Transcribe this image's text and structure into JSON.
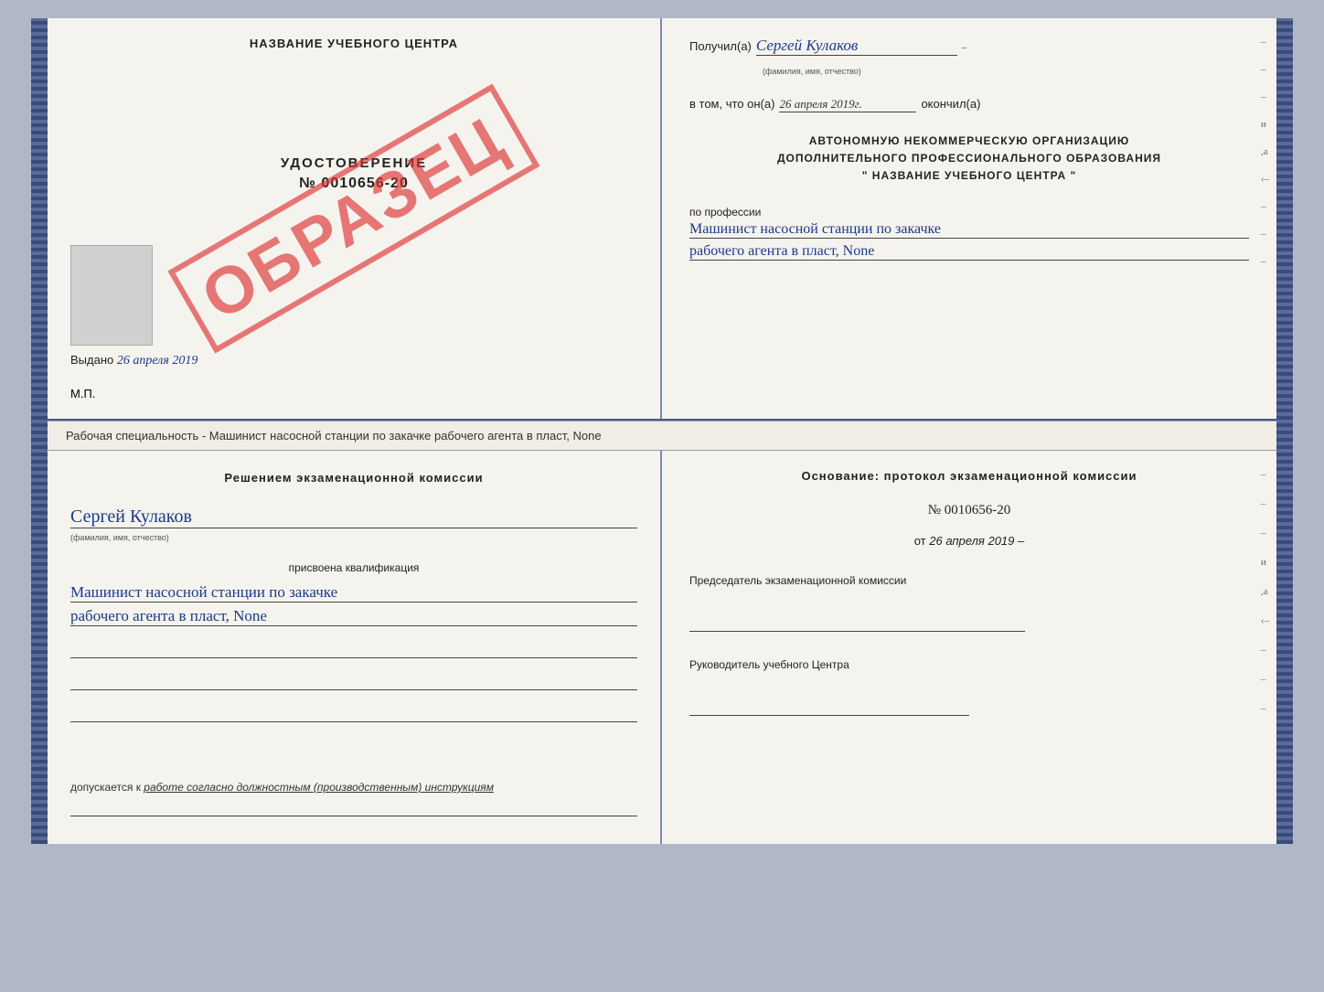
{
  "document": {
    "top": {
      "left": {
        "title": "НАЗВАНИЕ УЧЕБНОГО ЦЕНТРА",
        "cert_label": "УДОСТОВЕРЕНИЕ",
        "cert_number": "№ 0010656-20",
        "issued_prefix": "Выдано",
        "issued_date": "26 апреля 2019",
        "mp_label": "М.П.",
        "stamp_text": "ОБРАЗЕЦ"
      },
      "right": {
        "recipient_prefix": "Получил(а)",
        "recipient_name": "Сергей Кулаков",
        "recipient_sub": "(фамилия, имя, отчество)",
        "date_prefix": "в том, что он(а)",
        "date_value": "26 апреля 2019г.",
        "date_suffix": "окончил(а)",
        "org_line1": "АВТОНОМНУЮ НЕКОММЕРЧЕСКУЮ ОРГАНИЗАЦИЮ",
        "org_line2": "ДОПОЛНИТЕЛЬНОГО ПРОФЕССИОНАЛЬНОГО ОБРАЗОВАНИЯ",
        "org_line3": "\" НАЗВАНИЕ УЧЕБНОГО ЦЕНТРА \"",
        "profession_label": "по профессии",
        "profession_value1": "Машинист насосной станции по закачке",
        "profession_value2": "рабочего агента в пласт, None",
        "dash1": "–",
        "dash2": "–",
        "dash3": "–",
        "dash4": "и",
        "dash5": ",а",
        "dash6": "‹–",
        "dash7": "–",
        "dash8": "–",
        "dash9": "–"
      }
    },
    "separator": "Рабочая специальность - Машинист насосной станции по закачке рабочего агента в пласт, None",
    "bottom": {
      "left": {
        "commission_text": "Решением экзаменационной комиссии",
        "person_name": "Сергей Кулаков",
        "person_sub": "(фамилия, имя, отчество)",
        "qualification_prefix": "присвоена квалификация",
        "qualification1": "Машинист насосной станции по закачке",
        "qualification2": "рабочего агента в пласт, None",
        "admission_prefix": "допускается к",
        "admission_italic": "работе согласно должностным (производственным) инструкциям"
      },
      "right": {
        "basis_title": "Основание: протокол экзаменационной комиссии",
        "protocol_prefix": "№",
        "protocol_number": "0010656-20",
        "date_prefix": "от",
        "date_value": "26 апреля 2019",
        "chairman_label": "Председатель экзаменационной комиссии",
        "director_label": "Руководитель учебного Центра",
        "dash1": "–",
        "dash2": "–",
        "dash3": "–",
        "dash4": "и",
        "dash5": ",а",
        "dash6": "‹–",
        "dash7": "–",
        "dash8": "–",
        "dash9": "–"
      }
    }
  }
}
